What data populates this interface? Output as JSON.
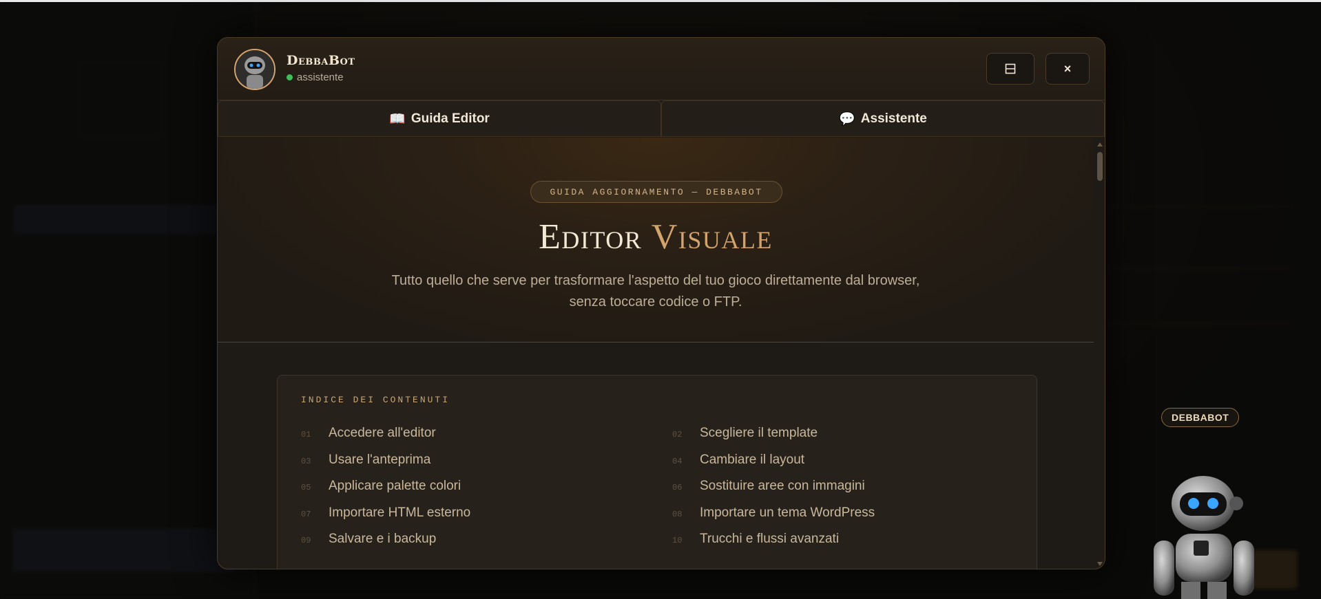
{
  "modal": {
    "bot_name": "DebbaBot",
    "status": "assistente",
    "expand_icon": "⊟",
    "close_icon": "×",
    "tabs": [
      {
        "icon": "📖",
        "label": "Guida Editor"
      },
      {
        "icon": "💬",
        "label": "Assistente"
      }
    ]
  },
  "hero": {
    "kicker": "GUIDA AGGIORNAMENTO — DEBBABOT",
    "title_main": "Editor",
    "title_accent": "Visuale",
    "subtitle": "Tutto quello che serve per trasformare l'aspetto del tuo gioco direttamente dal browser, senza toccare codice o FTP."
  },
  "toc": {
    "title": "INDICE DEI CONTENUTI",
    "items": [
      {
        "num": "01",
        "label": "Accedere all'editor"
      },
      {
        "num": "02",
        "label": "Scegliere il template"
      },
      {
        "num": "03",
        "label": "Usare l'anteprima"
      },
      {
        "num": "04",
        "label": "Cambiare il layout"
      },
      {
        "num": "05",
        "label": "Applicare palette colori"
      },
      {
        "num": "06",
        "label": "Sostituire aree con immagini"
      },
      {
        "num": "07",
        "label": "Importare HTML esterno"
      },
      {
        "num": "08",
        "label": "Importare un tema WordPress"
      },
      {
        "num": "09",
        "label": "Salvare e i backup"
      },
      {
        "num": "10",
        "label": "Trucchi e flussi avanzati"
      }
    ]
  },
  "mascot": {
    "badge": "DEBBABOT"
  },
  "colors": {
    "accent": "#d2a36c",
    "status_online": "#3fbf5a",
    "modal_bg": "#1e1a15"
  }
}
